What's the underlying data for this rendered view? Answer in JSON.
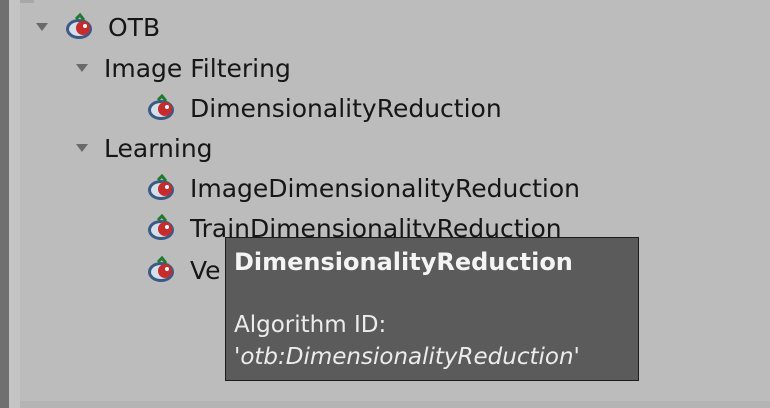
{
  "tree": {
    "root": {
      "label": "OTB",
      "icon": "otb-algorithm-icon",
      "expanded": true
    },
    "groups": [
      {
        "label": "Image Filtering",
        "expanded": true,
        "items": [
          {
            "label": "DimensionalityReduction",
            "icon": "otb-algorithm-icon"
          }
        ]
      },
      {
        "label": "Learning",
        "expanded": true,
        "items": [
          {
            "label": "ImageDimensionalityReduction",
            "icon": "otb-algorithm-icon"
          },
          {
            "label": "TrainDimensionalityReduction",
            "icon": "otb-algorithm-icon"
          },
          {
            "label": "Ve",
            "icon": "otb-algorithm-icon"
          }
        ]
      }
    ]
  },
  "tooltip": {
    "title": "DimensionalityReduction",
    "id_label": "Algorithm ID:",
    "quote_open": "'",
    "id_value": "otb:DimensionalityReduction",
    "quote_close": "'"
  },
  "colors": {
    "panel_bg": "#bcbcbc",
    "tooltip_bg": "#5b5b5b",
    "text": "#161616",
    "tooltip_text": "#ececec"
  }
}
